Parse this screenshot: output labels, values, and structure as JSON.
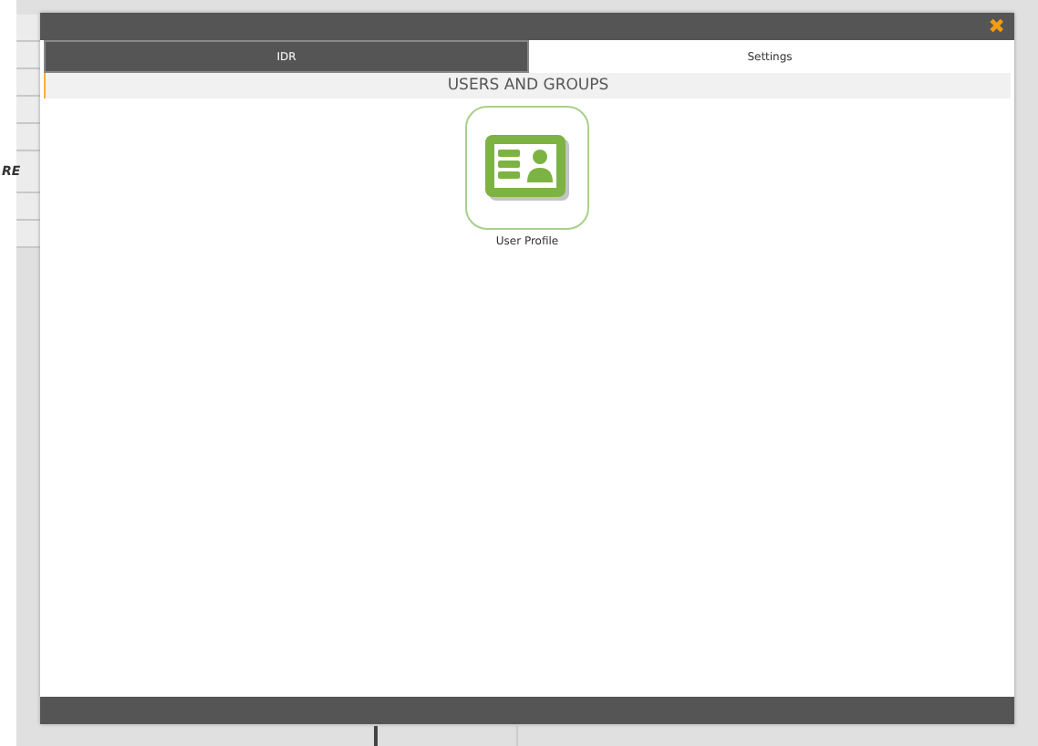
{
  "background": {
    "side_label": "RE"
  },
  "dialog": {
    "close": "✖",
    "tabs": [
      {
        "label": "IDR",
        "selected": false
      },
      {
        "label": "Settings",
        "selected": true
      }
    ],
    "section": {
      "title": "USERS AND GROUPS",
      "items": [
        {
          "label": "User Profile"
        }
      ]
    }
  }
}
